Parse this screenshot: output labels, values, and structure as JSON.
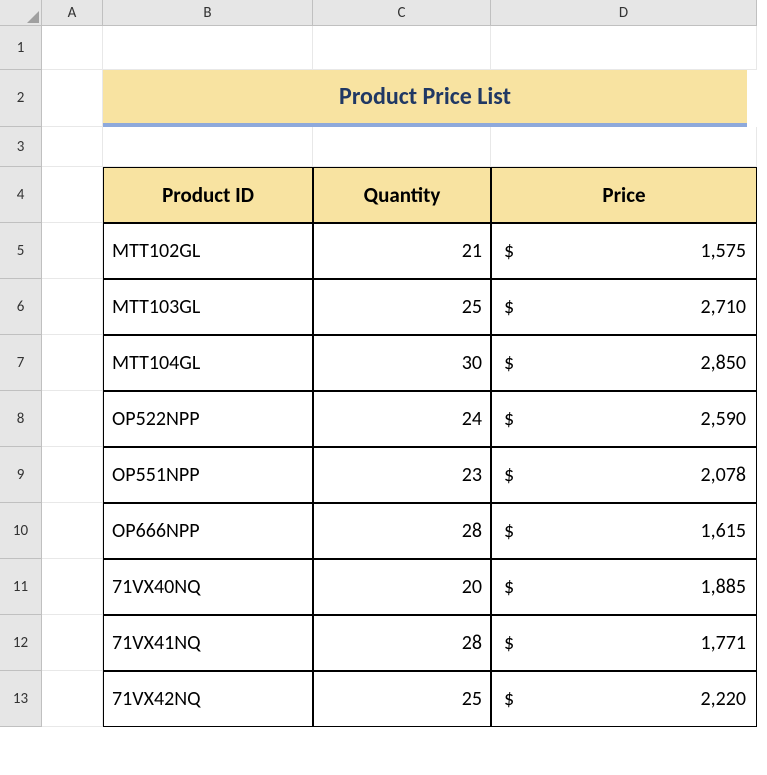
{
  "columns": [
    "A",
    "B",
    "C",
    "D"
  ],
  "rows": [
    "1",
    "2",
    "3",
    "4",
    "5",
    "6",
    "7",
    "8",
    "9",
    "10",
    "11",
    "12",
    "13"
  ],
  "title": "Product Price List",
  "headers": {
    "product_id": "Product ID",
    "quantity": "Quantity",
    "price": "Price"
  },
  "currency": "$",
  "data": [
    {
      "id": "MTT102GL",
      "qty": "21",
      "price": "1,575"
    },
    {
      "id": "MTT103GL",
      "qty": "25",
      "price": "2,710"
    },
    {
      "id": "MTT104GL",
      "qty": "30",
      "price": "2,850"
    },
    {
      "id": "OP522NPP",
      "qty": "24",
      "price": "2,590"
    },
    {
      "id": "OP551NPP",
      "qty": "23",
      "price": "2,078"
    },
    {
      "id": "OP666NPP",
      "qty": "28",
      "price": "1,615"
    },
    {
      "id": "71VX40NQ",
      "qty": "20",
      "price": "1,885"
    },
    {
      "id": "71VX41NQ",
      "qty": "28",
      "price": "1,771"
    },
    {
      "id": "71VX42NQ",
      "qty": "25",
      "price": "2,220"
    }
  ]
}
